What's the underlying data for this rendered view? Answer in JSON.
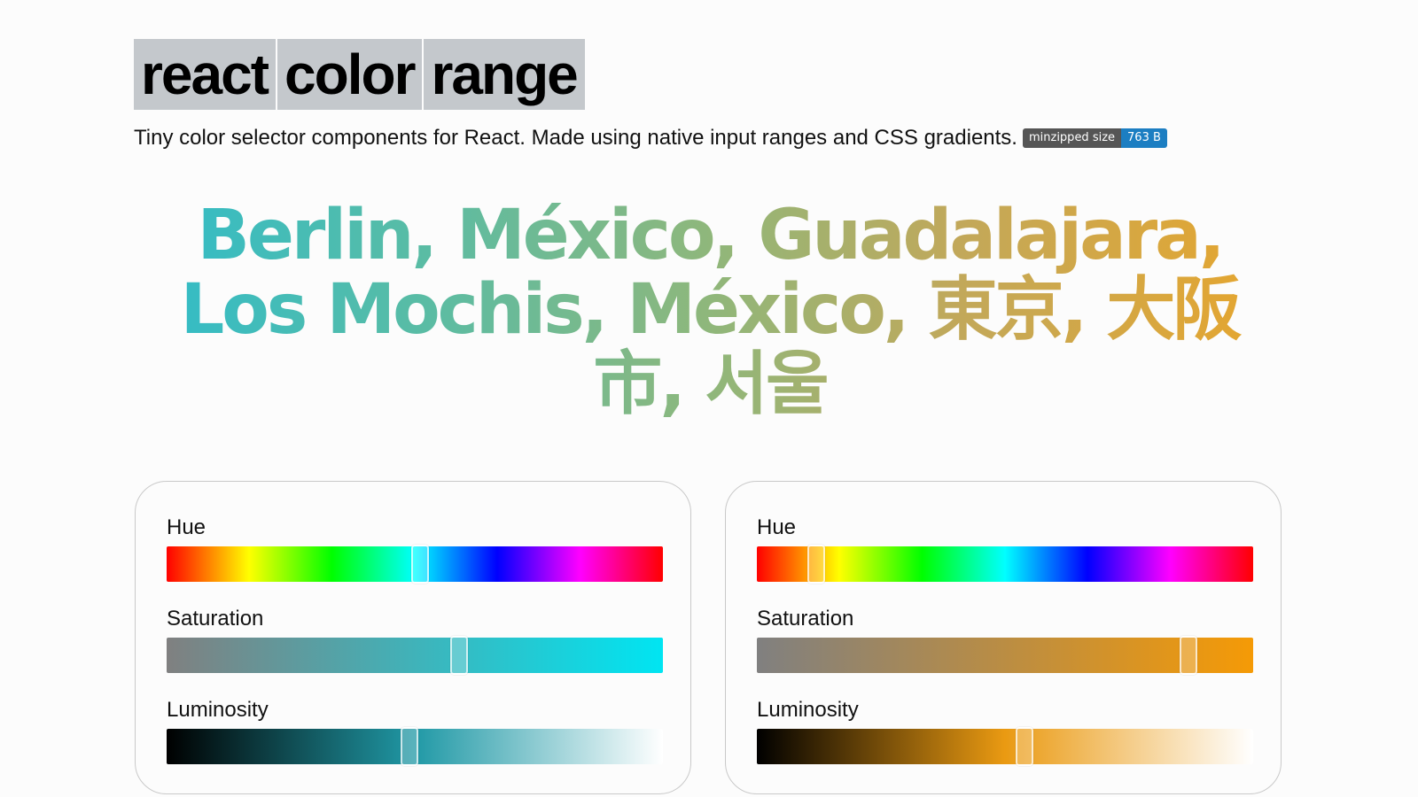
{
  "title": {
    "words": [
      "react",
      "color",
      "range"
    ]
  },
  "subtitle": {
    "text": "Tiny color selector components for React. Made using native input ranges and CSS gradients.",
    "badge_label": "minzipped size",
    "badge_value": "763 B"
  },
  "cities_text": "Berlin, México, Guadalajara, Los Mochis, México, 東京, 大阪市, 서울",
  "colors": {
    "gradient_start": "#30bcc9",
    "gradient_end": "#e7a62d",
    "title_bg": "#c4c8cc",
    "badge_label_bg": "#555555",
    "badge_value_bg": "#1c7ec2"
  },
  "panels": [
    {
      "hue_label": "Hue",
      "saturation_label": "Saturation",
      "luminosity_label": "Luminosity",
      "hue_value": 0.51,
      "saturation_value": 0.59,
      "luminosity_value": 0.49
    },
    {
      "hue_label": "Hue",
      "saturation_label": "Saturation",
      "luminosity_label": "Luminosity",
      "hue_value": 0.12,
      "saturation_value": 0.87,
      "luminosity_value": 0.54
    }
  ]
}
